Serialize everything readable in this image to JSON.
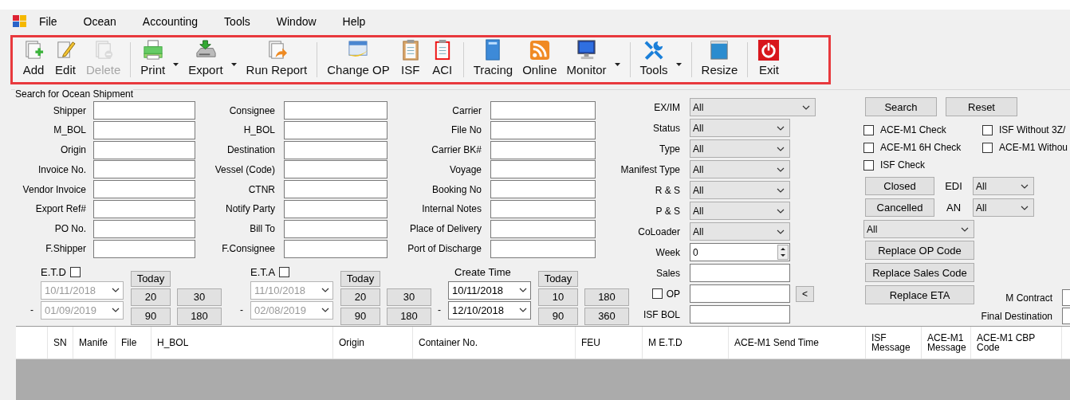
{
  "menu": [
    "File",
    "Ocean",
    "Accounting",
    "Tools",
    "Window",
    "Help"
  ],
  "toolbar": [
    {
      "kind": "button",
      "label": "Add",
      "disabled": false,
      "dropdown": false
    },
    {
      "kind": "button",
      "label": "Edit",
      "disabled": false,
      "dropdown": false
    },
    {
      "kind": "button",
      "label": "Delete",
      "disabled": true,
      "dropdown": false
    },
    {
      "kind": "separator"
    },
    {
      "kind": "button",
      "label": "Print",
      "disabled": false,
      "dropdown": true
    },
    {
      "kind": "button",
      "label": "Export",
      "disabled": false,
      "dropdown": true
    },
    {
      "kind": "button",
      "label": "Run Report",
      "disabled": false,
      "dropdown": false
    },
    {
      "kind": "separator"
    },
    {
      "kind": "button",
      "label": "Change OP",
      "disabled": false,
      "dropdown": false
    },
    {
      "kind": "button",
      "label": "ISF",
      "disabled": false,
      "dropdown": false
    },
    {
      "kind": "button",
      "label": "ACI",
      "disabled": false,
      "dropdown": false
    },
    {
      "kind": "separator"
    },
    {
      "kind": "button",
      "label": "Tracing",
      "disabled": false,
      "dropdown": false
    },
    {
      "kind": "button",
      "label": "Online",
      "disabled": false,
      "dropdown": false
    },
    {
      "kind": "button",
      "label": "Monitor",
      "disabled": false,
      "dropdown": true
    },
    {
      "kind": "separator"
    },
    {
      "kind": "button",
      "label": "Tools",
      "disabled": false,
      "dropdown": true
    },
    {
      "kind": "separator"
    },
    {
      "kind": "button",
      "label": "Resize",
      "disabled": false,
      "dropdown": false
    },
    {
      "kind": "separator"
    },
    {
      "kind": "button",
      "label": "Exit",
      "disabled": false,
      "dropdown": false
    }
  ],
  "search": {
    "title": "Search for Ocean Shipment",
    "field_columns": [
      [
        "Shipper",
        "M_BOL",
        "Origin",
        "Invoice No.",
        "Vendor Invoice",
        "Export Ref#",
        "PO No.",
        "F.Shipper"
      ],
      [
        "Consignee",
        "H_BOL",
        "Destination",
        "Vessel (Code)",
        "CTNR",
        "Notify Party",
        "Bill To",
        "F.Consignee"
      ],
      [
        "Carrier",
        "File No",
        "Carrier BK#",
        "Voyage",
        "Booking No",
        "Internal Notes",
        "Place of Delivery",
        "Port of Discharge"
      ]
    ],
    "date_ranges": [
      {
        "kind": "checkbox",
        "label": "E.T.D",
        "checked": false,
        "disabled": true,
        "separator": "-",
        "from": "10/11/2018",
        "to": "01/09/2019",
        "today": "Today",
        "quick": [
          "20",
          "30",
          "90",
          "180"
        ]
      },
      {
        "kind": "checkbox",
        "label": "E.T.A",
        "checked": false,
        "disabled": true,
        "separator": "-",
        "from": "11/10/2018",
        "to": "02/08/2019",
        "today": "Today",
        "quick": [
          "20",
          "30",
          "90",
          "180"
        ]
      },
      {
        "kind": "plain",
        "label": "Create Time",
        "disabled": false,
        "separator": "-",
        "from": "10/11/2018",
        "to": "12/10/2018",
        "today": "Today",
        "quick": [
          "10",
          "180",
          "90",
          "360"
        ]
      }
    ],
    "filters": [
      {
        "kind": "select",
        "label": "EX/IM",
        "value": "All"
      },
      {
        "kind": "select",
        "label": "Status",
        "value": "All"
      },
      {
        "kind": "select",
        "label": "Type",
        "value": "All"
      },
      {
        "kind": "select",
        "label": "Manifest Type",
        "value": "All"
      },
      {
        "kind": "select",
        "label": "R & S",
        "value": "All"
      },
      {
        "kind": "select",
        "label": "P & S",
        "value": "All"
      },
      {
        "kind": "select",
        "label": "CoLoader",
        "value": "All"
      },
      {
        "kind": "spin",
        "label": "Week",
        "value": "0"
      },
      {
        "kind": "text",
        "label": "Sales"
      },
      {
        "kind": "checkbox-text",
        "label": "OP",
        "checked": false,
        "button": "<"
      },
      {
        "kind": "text",
        "label": "ISF BOL"
      }
    ],
    "search_button": "Search",
    "reset_button": "Reset",
    "checks": [
      {
        "label": "ACE-M1 Check",
        "checked": false
      },
      {
        "label": "ISF Without 3Z/",
        "checked": false
      },
      {
        "label": "ACE-M1 6H Check",
        "checked": false
      },
      {
        "label": "ACE-M1 Withou",
        "checked": false
      },
      {
        "label": "ISF Check",
        "checked": false
      }
    ],
    "status_filters": [
      {
        "button": "Closed",
        "label": "EDI",
        "value": "All"
      },
      {
        "button": "Cancelled",
        "label": "AN",
        "value": "All"
      }
    ],
    "extra_select": {
      "value": "All"
    },
    "replace_buttons": [
      "Replace OP Code",
      "Replace Sales Code",
      "Replace ETA"
    ],
    "extra_fields": [
      {
        "label": "M Contract"
      },
      {
        "label": "Final Destination"
      }
    ]
  },
  "table": {
    "columns": [
      "SN",
      "Manife",
      "File",
      "H_BOL",
      "Origin",
      "Container No.",
      "FEU",
      "M E.T.D",
      "ACE-M1 Send Time",
      "ISF Message",
      "ACE-M1 Message",
      "ACE-M1 CBP Code"
    ]
  }
}
